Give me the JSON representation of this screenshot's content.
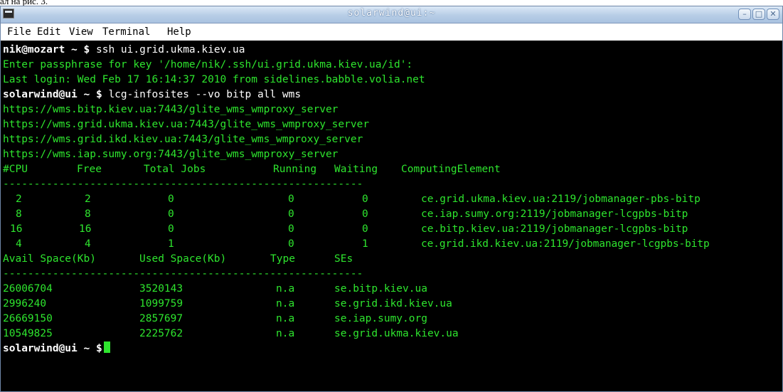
{
  "caption": "ал на рис. 3.",
  "window": {
    "title": "solarwind@ui:~"
  },
  "menu": [
    "File",
    "Edit",
    "View",
    "Terminal",
    "Help"
  ],
  "prompt1": {
    "user": "nik@mozart",
    "path": "~",
    "sym": "$",
    "cmd": "ssh ui.grid.ukma.kiev.ua"
  },
  "out1": "Enter passphrase for key '/home/nik/.ssh/ui.grid.ukma.kiev.ua/id':",
  "out2": "Last login: Wed Feb 17 16:14:37 2010 from sidelines.babble.volia.net",
  "prompt2": {
    "user": "solarwind@ui",
    "path": "~",
    "sym": "$",
    "cmd": "lcg-infosites --vo bitp all wms"
  },
  "wms": [
    "https://wms.bitp.kiev.ua:7443/glite_wms_wmproxy_server",
    "https://wms.grid.ukma.kiev.ua:7443/glite_wms_wmproxy_server",
    "https://wms.grid.ikd.kiev.ua:7443/glite_wms_wmproxy_server",
    "https://wms.iap.sumy.org:7443/glite_wms_wmproxy_server"
  ],
  "ce_header": [
    "#CPU",
    "Free",
    "Total Jobs",
    "Running",
    "Waiting",
    "ComputingElement"
  ],
  "sep1": "----------------------------------------------------------",
  "ce_rows": [
    [
      "2",
      "2",
      "0",
      "0",
      "0",
      "ce.grid.ukma.kiev.ua:2119/jobmanager-pbs-bitp"
    ],
    [
      "8",
      "8",
      "0",
      "0",
      "0",
      "ce.iap.sumy.org:2119/jobmanager-lcgpbs-bitp"
    ],
    [
      "16",
      "16",
      "0",
      "0",
      "0",
      "ce.bitp.kiev.ua:2119/jobmanager-lcgpbs-bitp"
    ],
    [
      "4",
      "4",
      "1",
      "0",
      "1",
      "ce.grid.ikd.kiev.ua:2119/jobmanager-lcgpbs-bitp"
    ]
  ],
  "se_header": [
    "Avail Space(Kb)",
    "Used Space(Kb)",
    "Type",
    "SEs"
  ],
  "sep2": "----------------------------------------------------------",
  "se_rows": [
    [
      "26006704",
      "3520143",
      "n.a",
      "se.bitp.kiev.ua"
    ],
    [
      "2996240",
      "1099759",
      "n.a",
      "se.grid.ikd.kiev.ua"
    ],
    [
      "26669150",
      "2857697",
      "n.a",
      "se.iap.sumy.org"
    ],
    [
      "10549825",
      "2225762",
      "n.a",
      "se.grid.ukma.kiev.ua"
    ]
  ],
  "prompt3": {
    "user": "solarwind@ui",
    "path": "~",
    "sym": "$"
  },
  "colors": {
    "terminal_text": "#2ee52e",
    "background": "#000000",
    "titlebar": "#b7cde6"
  }
}
